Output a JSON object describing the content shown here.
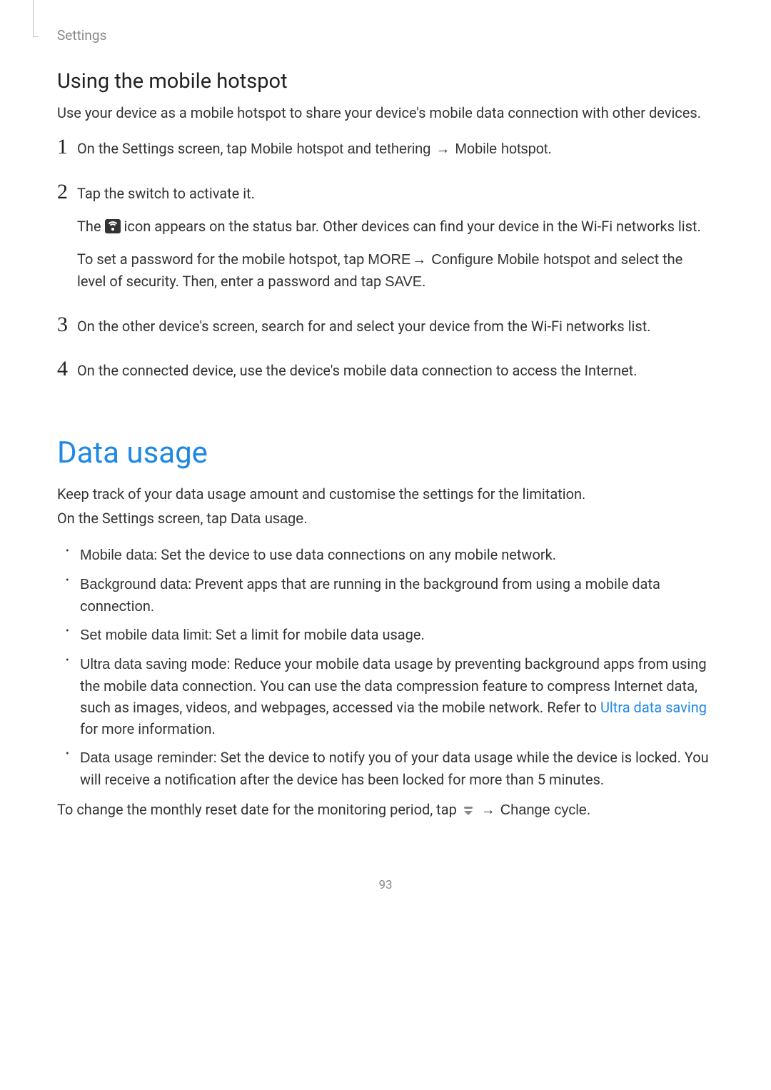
{
  "runningHead": "Settings",
  "hotspot": {
    "heading": "Using the mobile hotspot",
    "intro": "Use your device as a mobile hotspot to share your device's mobile data connection with other devices.",
    "step1_a": "On the Settings screen, tap ",
    "step1_b": "Mobile hotspot and tethering",
    "step1_c": "Mobile hotspot",
    "step1_d": ".",
    "step2_a": "Tap the switch to activate it.",
    "step2_b1": "The ",
    "step2_b2": " icon appears on the status bar. Other devices can find your device in the Wi-Fi networks list.",
    "step2_c1": "To set a password for the mobile hotspot, tap ",
    "step2_c2": "MORE",
    "step2_c3": "Configure Mobile hotspot",
    "step2_c4": " and select the level of security. Then, enter a password and tap ",
    "step2_c5": "SAVE",
    "step2_c6": ".",
    "step3": "On the other device's screen, search for and select your device from the Wi-Fi networks list.",
    "step4": "On the connected device, use the device's mobile data connection to access the Internet."
  },
  "dataUsage": {
    "title": "Data usage",
    "intro1": "Keep track of your data usage amount and customise the settings for the limitation.",
    "intro2a": "On the Settings screen, tap ",
    "intro2b": "Data usage",
    "intro2c": ".",
    "bullets": {
      "b1t": "Mobile data",
      "b1b": ": Set the device to use data connections on any mobile network.",
      "b2t": "Background data",
      "b2b": ": Prevent apps that are running in the background from using a mobile data connection.",
      "b3t": "Set mobile data limit",
      "b3b": ": Set a limit for mobile data usage.",
      "b4t": "Ultra data saving mode",
      "b4b1": ": Reduce your mobile data usage by preventing background apps from using the mobile data connection. You can use the data compression feature to compress Internet data, such as images, videos, and webpages, accessed via the mobile network. Refer to ",
      "b4link": "Ultra data saving",
      "b4b2": " for more information.",
      "b5t": "Data usage reminder",
      "b5b": ": Set the device to notify you of your data usage while the device is locked. You will receive a notification after the device has been locked for more than 5 minutes."
    },
    "footer_a": "To change the monthly reset date for the monitoring period, tap ",
    "footer_b": "Change cycle",
    "footer_c": "."
  },
  "arrow": "→",
  "pageNumber": "93"
}
